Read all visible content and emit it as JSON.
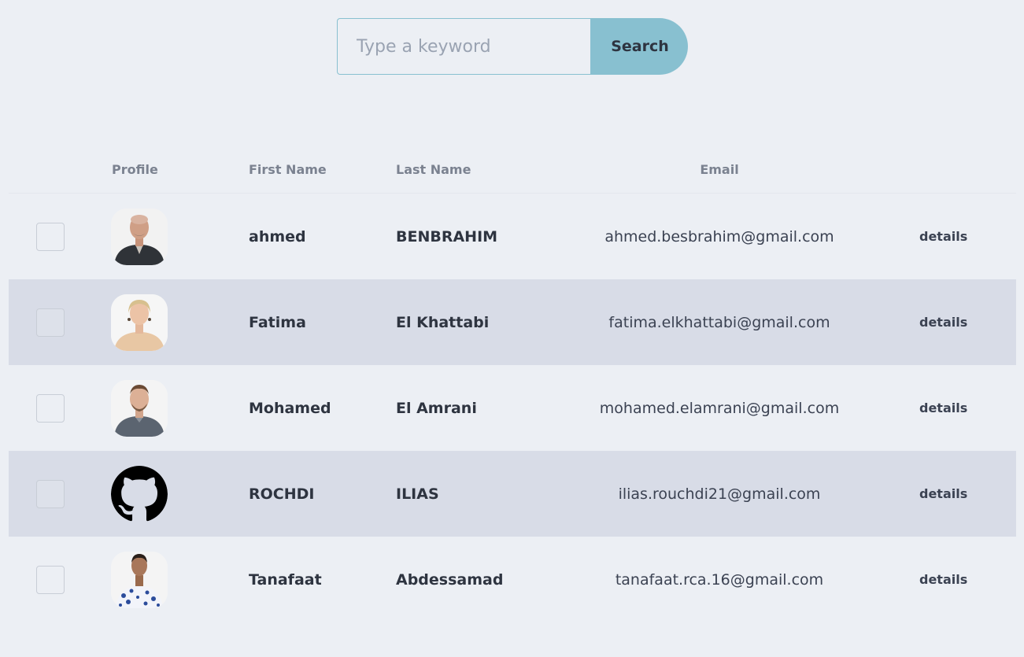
{
  "search": {
    "placeholder": "Type a keyword",
    "value": "",
    "button_label": "Search"
  },
  "table": {
    "columns": {
      "profile": "Profile",
      "first_name": "First Name",
      "last_name": "Last Name",
      "email": "Email"
    },
    "rows": [
      {
        "first_name": "ahmed",
        "last_name": "BENBRAHIM",
        "email": "ahmed.besbrahim@gmail.com",
        "action": "details",
        "avatar": "person-photo-avatar"
      },
      {
        "first_name": "Fatima",
        "last_name": "El Khattabi",
        "email": "fatima.elkhattabi@gmail.com",
        "action": "details",
        "avatar": "person-photo-avatar"
      },
      {
        "first_name": "Mohamed",
        "last_name": "El Amrani",
        "email": "mohamed.elamrani@gmail.com",
        "action": "details",
        "avatar": "person-photo-avatar"
      },
      {
        "first_name": "ROCHDI",
        "last_name": "ILIAS",
        "email": "ilias.rouchdi21@gmail.com",
        "action": "details",
        "avatar": "github-icon"
      },
      {
        "first_name": "Tanafaat",
        "last_name": "Abdessamad",
        "email": "tanafaat.rca.16@gmail.com",
        "action": "details",
        "avatar": "person-photo-avatar"
      }
    ]
  },
  "colors": {
    "background": "#eceff4",
    "accent": "#88c0d0",
    "row_alt": "#d8dce7",
    "text": "#2e3440"
  }
}
